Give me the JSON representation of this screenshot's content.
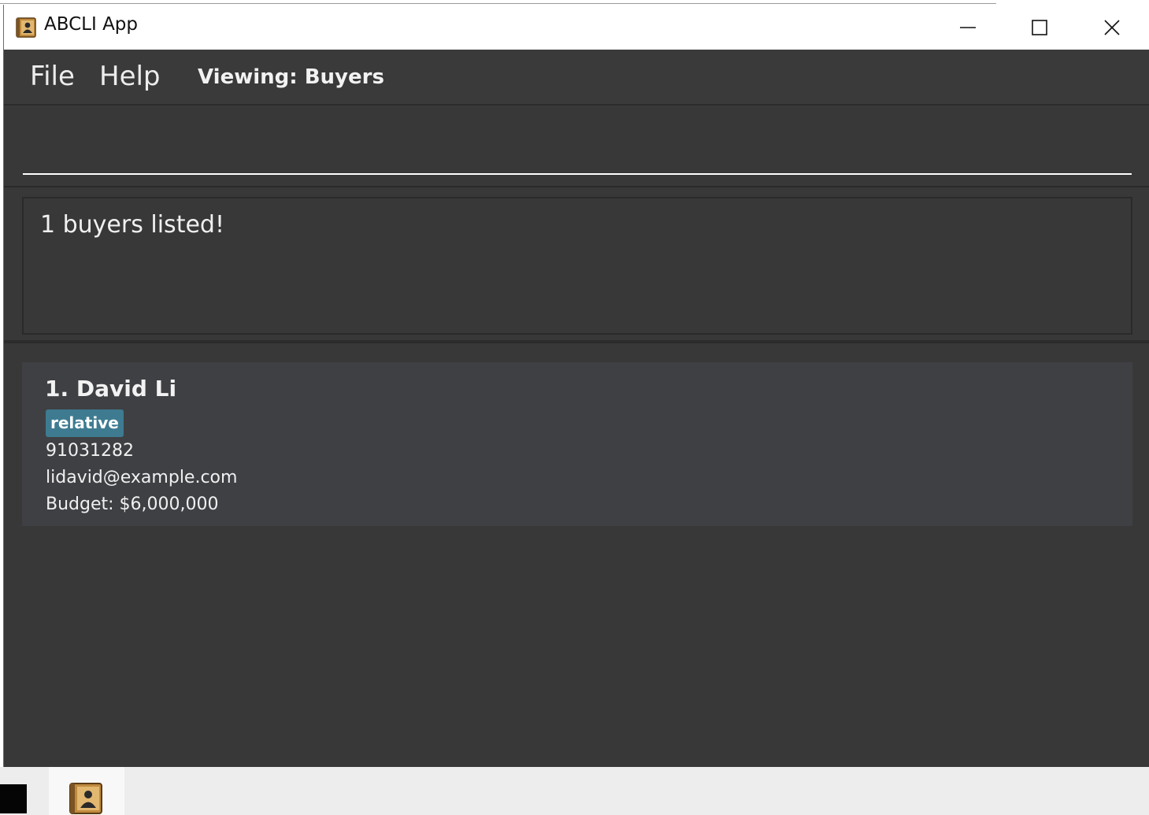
{
  "window": {
    "title": "ABCLI App",
    "icon": "address-book-icon"
  },
  "menubar": {
    "file_label": "File",
    "help_label": "Help",
    "viewing_label": "Viewing: Buyers"
  },
  "command": {
    "value": "",
    "placeholder": ""
  },
  "result": {
    "message": "1 buyers listed!"
  },
  "buyers": [
    {
      "name": "1. David Li",
      "tags": [
        "relative"
      ],
      "phone": "91031282",
      "email": "lidavid@example.com",
      "budget": "Budget: $6,000,000"
    }
  ],
  "colors": {
    "background": "#383838",
    "card": "#3f4044",
    "tag": "#3e7b91",
    "text": "#f0f0f0"
  },
  "taskbar": {
    "items": [
      "terminal-icon",
      "address-book-icon"
    ]
  }
}
